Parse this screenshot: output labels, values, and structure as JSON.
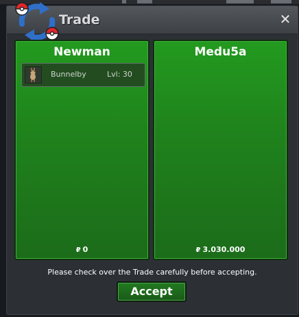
{
  "window": {
    "title": "Trade",
    "close_label": "✕"
  },
  "left_panel": {
    "name": "Newman",
    "items": [
      {
        "name": "Bunnelby",
        "level": "Lvl: 30",
        "icon": "bunnelby-sprite"
      }
    ],
    "currency_symbol": "₽",
    "money": "0"
  },
  "right_panel": {
    "name": "Medu5a",
    "currency_symbol": "₽",
    "money": "3.030.000"
  },
  "notice": "Please check over the Trade carefully before accepting.",
  "accept_label": "Accept",
  "colors": {
    "panel_green": "#1f811c",
    "window_bg": "#2c3035",
    "titlebar": "#4a4d52"
  }
}
